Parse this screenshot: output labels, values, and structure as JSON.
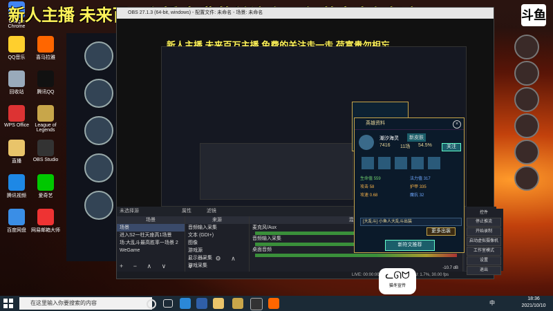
{
  "overlay_text": "新人主播 未来百万主播 免费的关注走一走 荷富贵勿相忘",
  "logo_text": "斗鱼",
  "desktop_icons": [
    {
      "label": "Google Chrome",
      "color": "#4285f4"
    },
    {
      "label": "QQ音乐",
      "color": "#ffcf2d"
    },
    {
      "label": "回收站",
      "color": "#9ab"
    },
    {
      "label": "WPS Office",
      "color": "#d33"
    },
    {
      "label": "直播",
      "color": "#e9c46a"
    },
    {
      "label": "腾讯视频",
      "color": "#1e88e5"
    },
    {
      "label": "百度网盘",
      "color": "#3a8ee6"
    },
    {
      "label": "喜马拉雅",
      "color": "#f60"
    },
    {
      "label": "腾讯QQ",
      "color": "#111"
    },
    {
      "label": "League of Legends",
      "color": "#c8a64a"
    },
    {
      "label": "OBS Studio",
      "color": "#333"
    },
    {
      "label": "爱奇艺",
      "color": "#00c800"
    },
    {
      "label": "网易邮箱大师",
      "color": "#e33"
    }
  ],
  "obs": {
    "title": "OBS 27.1.3 (64-bit, windows) - 配置文件: 未命名 - 场景: 未命名",
    "no_source": "未选择源",
    "props_btn": "属性",
    "filter_btn": "滤镜",
    "scenes_header": "场景",
    "scenes": [
      "场景",
      "进入S2一柱天座高1场景",
      "场:大乱斗最高胜率一场景 2",
      "WeGame"
    ],
    "sources_header": "来源",
    "sources": [
      "音频输入采集",
      "文本 (GDI+)",
      "图像",
      "游戏源",
      "显示器采集",
      "游戏采集"
    ],
    "mixer_header": "混音器",
    "mixer": [
      {
        "label": "麦克风/Aux",
        "db": "0.0 dB"
      },
      {
        "label": "音频输入采集",
        "db": "0.0 dB"
      },
      {
        "label": "桌面音频",
        "db": "-10.7 dB"
      }
    ],
    "status": "LIVE: 00:00:00   REC: 00:00:00   CPU: 1.7%, 30.00 fps"
  },
  "hero_popup": {
    "title": "英雄资料",
    "hero_name": "潮汐海灵",
    "badge": "新皮肤",
    "stats": [
      "7416",
      "11场",
      "54.5%"
    ],
    "button_more": "更多出装",
    "button_recommend": "新符文推荐",
    "mode_label": "[大乱斗] 小鱼人大乱斗出装",
    "follow": "关注",
    "stat_rows": [
      {
        "k": "生命值",
        "v": "559"
      },
      {
        "k": "法力值",
        "v": "317"
      },
      {
        "k": "攻击",
        "v": "58"
      },
      {
        "k": "护甲",
        "v": "335"
      },
      {
        "k": "攻速",
        "v": "0.68"
      },
      {
        "k": "魔抗",
        "v": "32"
      }
    ]
  },
  "right_dock": [
    "控件",
    "停止推流",
    "开始录制",
    "启动虚拟摄像机",
    "工作室模式",
    "设置",
    "退出"
  ],
  "cat_label": "猫冬宣传",
  "taskbar": {
    "search_placeholder": "在这里输入你要搜索的内容",
    "time": "18:36",
    "date": "2021/10/10",
    "lang": "中"
  }
}
